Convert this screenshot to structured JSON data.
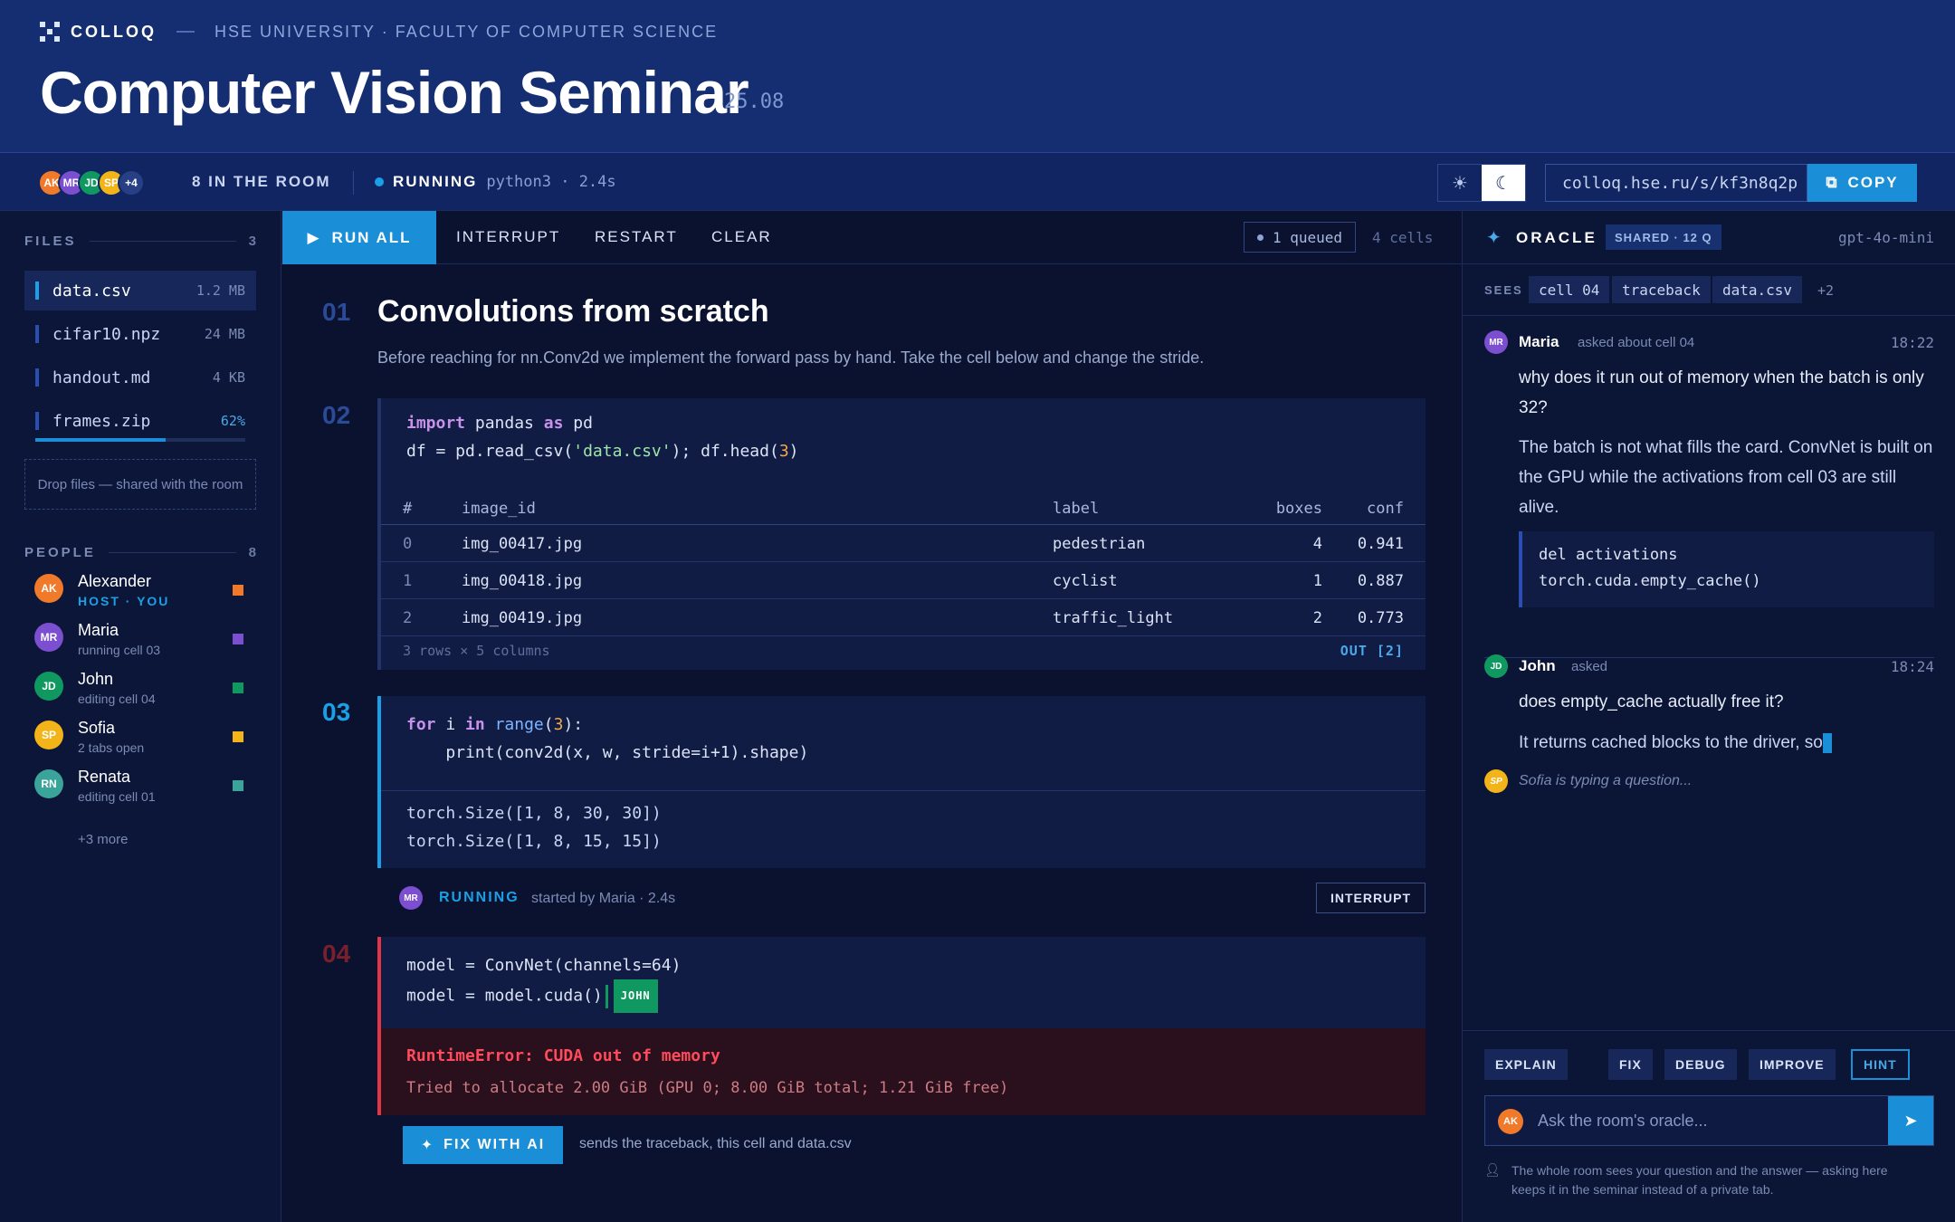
{
  "header": {
    "brand": "COLLOQ",
    "institution": "HSE UNIVERSITY · FACULTY OF COMPUTER SCIENCE",
    "title": "Computer Vision Seminar",
    "date": "25.08"
  },
  "roombar": {
    "avatars": [
      {
        "initials": "AK",
        "color": "#f07a2a"
      },
      {
        "initials": "MR",
        "color": "#7b4fd0"
      },
      {
        "initials": "JD",
        "color": "#0f9960"
      },
      {
        "initials": "SP",
        "color": "#f2b418"
      }
    ],
    "more_avatars": "+4",
    "in_room": "8 IN THE ROOM",
    "status": "RUNNING",
    "kernel": "python3 · 2.4s",
    "theme_light_icon": "sun-icon",
    "theme_dark_icon": "moon-icon",
    "share_url": "colloq.hse.ru/s/kf3n8q2p",
    "copy_label": "COPY"
  },
  "files": {
    "heading": "FILES",
    "count": "3",
    "items": [
      {
        "name": "data.csv",
        "size": "1.2 MB"
      },
      {
        "name": "cifar10.npz",
        "size": "24 MB"
      },
      {
        "name": "handout.md",
        "size": "4 KB"
      },
      {
        "name": "frames.zip",
        "size": "62%"
      }
    ],
    "upload_progress": 0.62,
    "drop_hint": "Drop files — shared with the room"
  },
  "people": {
    "heading": "PEOPLE",
    "count": "8",
    "items": [
      {
        "initials": "AK",
        "name": "Alexander",
        "status": "HOST · YOU",
        "color": "#f07a2a"
      },
      {
        "initials": "MR",
        "name": "Maria",
        "status": "running cell 03",
        "color": "#7b4fd0"
      },
      {
        "initials": "JD",
        "name": "John",
        "status": "editing cell 04",
        "color": "#0f9960"
      },
      {
        "initials": "SP",
        "name": "Sofia",
        "status": "2 tabs open",
        "color": "#f2b418"
      },
      {
        "initials": "RN",
        "name": "Renata",
        "status": "editing cell 01",
        "color": "#3aa39a"
      }
    ],
    "more": "+3 more"
  },
  "toolbar": {
    "run_all": "RUN ALL",
    "interrupt": "INTERRUPT",
    "restart": "RESTART",
    "clear": "CLEAR",
    "queued": "1 queued",
    "cells": "4 cells"
  },
  "cells": {
    "c1": {
      "num": "01",
      "title": "Convolutions from scratch",
      "text": "Before reaching for nn.Conv2d we implement the forward pass by hand. Take the cell below and change the stride."
    },
    "c2": {
      "num": "02",
      "line1": {
        "kw1": "import",
        "mod": " pandas ",
        "kw2": "as",
        "alias": " pd"
      },
      "line2": {
        "a": "df = pd.read_csv(",
        "str": "'data.csv'",
        "b": "); df.head(",
        "n": "3",
        "c": ")"
      },
      "table": {
        "headers": [
          "#",
          "image_id",
          "label",
          "boxes",
          "conf"
        ],
        "rows": [
          [
            "0",
            "img_00417.jpg",
            "pedestrian",
            "4",
            "0.941"
          ],
          [
            "1",
            "img_00418.jpg",
            "cyclist",
            "1",
            "0.887"
          ],
          [
            "2",
            "img_00419.jpg",
            "traffic_light",
            "2",
            "0.773"
          ]
        ],
        "footer": "3 rows × 5 columns",
        "out": "OUT [2]"
      }
    },
    "c3": {
      "num": "03",
      "line1": {
        "kw1": "for",
        "a": " i ",
        "kw2": "in",
        "sp": " ",
        "fn": "range",
        "b": "(",
        "n": "3",
        "c": "):"
      },
      "line2": "    print(conv2d(x, w, stride=i+1).shape)",
      "out1": "torch.Size([1, 8, 30, 30])",
      "out2": "torch.Size([1, 8, 15, 15])",
      "runner": "MR",
      "status": "RUNNING",
      "started": "started by Maria · 2.4s",
      "interrupt": "INTERRUPT"
    },
    "c4": {
      "num": "04",
      "line1": "model = ConvNet(channels=64)",
      "line2": "model = model.cuda()",
      "editor_tag": "JOHN",
      "error_title": "RuntimeError: CUDA out of memory",
      "error_detail": "Tried to allocate 2.00 GiB (GPU 0; 8.00 GiB total; 1.21 GiB free)",
      "fix_label": "FIX WITH AI",
      "fix_note": "sends the traceback, this cell and data.csv"
    }
  },
  "oracle": {
    "title": "ORACLE",
    "shared": "SHARED · 12 Q",
    "model": "gpt-4o-mini",
    "sees_label": "SEES",
    "sees": [
      "cell 04",
      "traceback",
      "data.csv"
    ],
    "sees_more": "+2",
    "messages": [
      {
        "initials": "MR",
        "color": "#7b4fd0",
        "name": "Maria",
        "meta": "asked about cell 04",
        "time": "18:22",
        "question": "why does it run out of memory when the batch is only 32?",
        "answer": "The batch is not what fills the card. ConvNet is built on the GPU while the activations from cell 03 are still alive.",
        "code1": "del activations",
        "code2": "torch.cuda.empty_cache()"
      },
      {
        "initials": "JD",
        "color": "#0f9960",
        "name": "John",
        "meta": "asked",
        "time": "18:24",
        "question": "does empty_cache actually free it?",
        "answer": "It returns cached blocks to the driver, so"
      }
    ],
    "typing_initials": "SP",
    "typing": "Sofia is typing a question...",
    "quick_actions": [
      "EXPLAIN",
      "FIX",
      "DEBUG",
      "IMPROVE",
      "HINT"
    ],
    "ask_initials": "AK",
    "ask_placeholder": "Ask the room's oracle...",
    "note": "The whole room sees your question and the answer — asking here keeps it in the seminar instead of a private tab."
  }
}
